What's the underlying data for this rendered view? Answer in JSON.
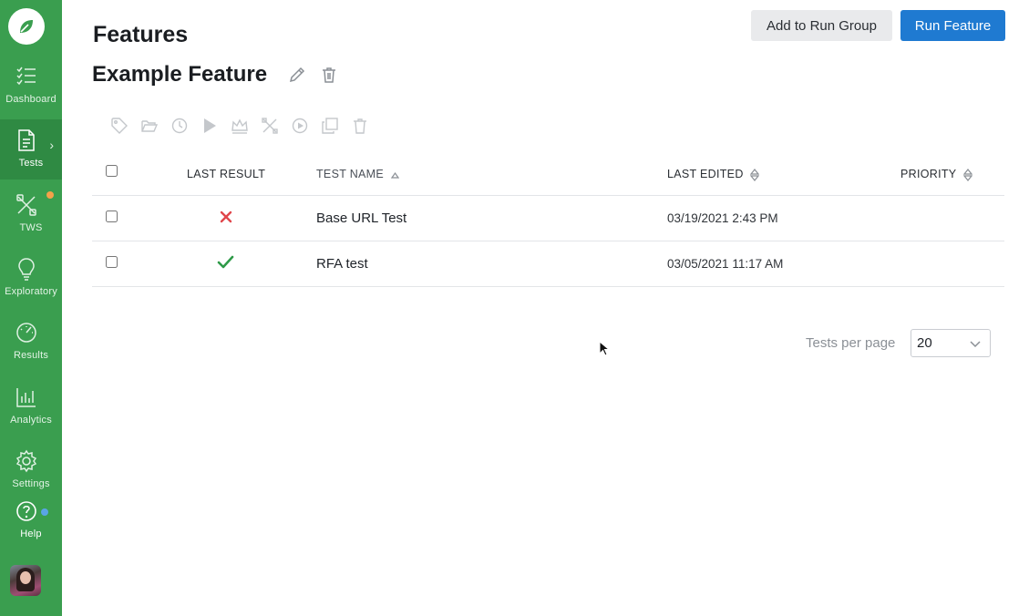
{
  "sidebar": {
    "items": [
      {
        "label": "Dashboard",
        "icon": "checklist-icon"
      },
      {
        "label": "Tests",
        "icon": "document-icon",
        "active": true
      },
      {
        "label": "TWS",
        "icon": "tools-icon",
        "badge_color": "#f5a14a"
      },
      {
        "label": "Exploratory",
        "icon": "lightbulb-icon"
      },
      {
        "label": "Results",
        "icon": "gauge-icon"
      },
      {
        "label": "Analytics",
        "icon": "bar-chart-icon"
      },
      {
        "label": "Settings",
        "icon": "gear-icon"
      },
      {
        "label": "Help",
        "icon": "help-icon",
        "badge_color": "#5aa5e6"
      }
    ]
  },
  "header": {
    "page_title": "Features",
    "feature_title": "Example Feature",
    "add_to_run_group_label": "Add to Run Group",
    "run_feature_label": "Run Feature"
  },
  "toolbar": {
    "icons": [
      "tag-icon",
      "folder-icon",
      "clock-icon",
      "play-icon",
      "crown-icon",
      "tools-icon",
      "play-circle-icon",
      "copy-icon",
      "trash-icon"
    ]
  },
  "table": {
    "columns": {
      "last_result": "LAST RESULT",
      "test_name": "TEST NAME",
      "last_edited": "LAST EDITED",
      "priority": "PRIORITY"
    },
    "rows": [
      {
        "result": "failed",
        "name": "Base URL Test",
        "last_edited": "03/19/2021 2:43 PM",
        "priority": ""
      },
      {
        "result": "passed",
        "name": "RFA test",
        "last_edited": "03/05/2021 11:17 AM",
        "priority": ""
      }
    ]
  },
  "pagination": {
    "label": "Tests per page",
    "value": "20"
  },
  "colors": {
    "sidebar": "#3a9e4f",
    "primary": "#1f7ad1",
    "fail": "#e0464b",
    "pass": "#2e9a48"
  }
}
